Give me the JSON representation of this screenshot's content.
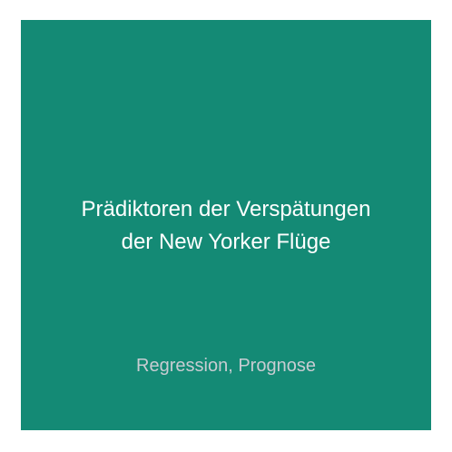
{
  "card": {
    "background": "#148a75",
    "title_lines": [
      "Prädiktoren der Verspätungen",
      "der New Yorker Flüge"
    ],
    "subtitle": "Regression, Prognose"
  }
}
